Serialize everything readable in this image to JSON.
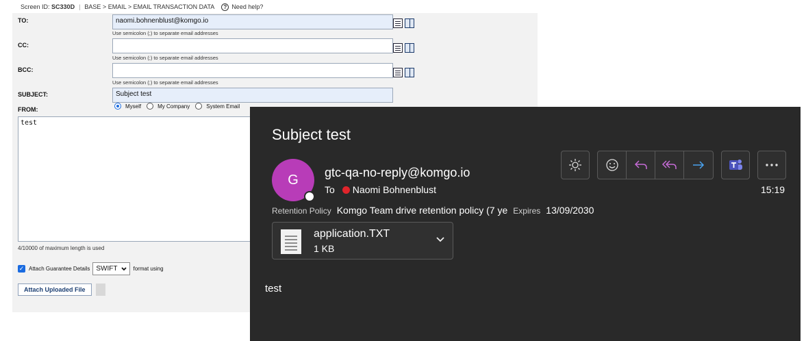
{
  "topbar": {
    "screen_id_label": "Screen ID:",
    "screen_id": "SC330D",
    "breadcrumb": "BASE > EMAIL > EMAIL TRANSACTION DATA",
    "help_glyph": "?",
    "help": "Need help?"
  },
  "form": {
    "to_label": "TO:",
    "to_value": "naomi.bohnenblust@komgo.io",
    "cc_label": "CC:",
    "cc_value": "",
    "bcc_label": "BCC:",
    "bcc_value": "",
    "hint": "Use semicolon (;) to separate email addresses",
    "subject_label": "SUBJECT:",
    "subject_value": "Subject test",
    "from_label": "FROM:",
    "from_options": [
      "Myself",
      "My Company",
      "System Email"
    ],
    "from_selected": "Myself",
    "body_value": "test",
    "max_length_text": "4/10000 of maximum length is used",
    "attach_guarantee_label": "Attach Guarantee Details",
    "attach_guarantee_checked": true,
    "format_value": "SWIFT",
    "format_suffix": "format using",
    "attach_button": "Attach Uploaded File"
  },
  "mail": {
    "subject": "Subject test",
    "avatar_initial": "G",
    "avatar_color": "#b83cb8",
    "sender": "gtc-qa-no-reply@komgo.io",
    "to_label": "To",
    "recipient": "Naomi Bohnenblust",
    "time": "15:19",
    "retention_label": "Retention Policy",
    "retention_value": "Komgo Team drive retention policy (7 ye",
    "expires_label": "Expires",
    "expires_value": "13/09/2030",
    "attachment_name": "application.TXT",
    "attachment_size": "1 KB",
    "body": "test",
    "icons": [
      "sun-icon",
      "emoji-icon",
      "reply-icon",
      "reply-all-icon",
      "forward-icon",
      "teams-icon",
      "more-icon"
    ]
  }
}
